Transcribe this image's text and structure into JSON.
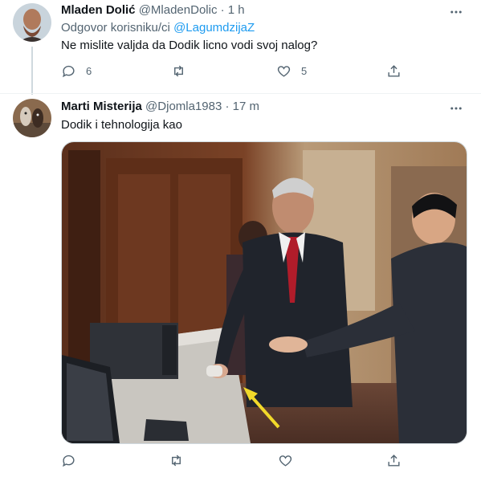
{
  "tweet1": {
    "display_name": "Mladen Dolić",
    "handle": "@MladenDolic",
    "separator": "·",
    "time": "1 h",
    "reply_prefix": "Odgovor korisniku/ci",
    "reply_mention": "@LagumdzijaZ",
    "text": "Ne mislite valjda da Dodik licno vodi svoj nalog?",
    "reply_count": "6",
    "retweet_count": "",
    "like_count": "5"
  },
  "tweet2": {
    "display_name": "Marti Misterija",
    "handle": "@Djomla1983",
    "separator": "·",
    "time": "17 m",
    "text": "Dodik i tehnologija kao",
    "reply_count": "",
    "retweet_count": "",
    "like_count": ""
  },
  "icons": {
    "more": "more-horizontal-icon",
    "reply": "reply-icon",
    "retweet": "retweet-icon",
    "like": "heart-icon",
    "share": "share-icon"
  },
  "colors": {
    "accent": "#1d9bf0",
    "secondary_text": "#536471",
    "primary_text": "#0f1419",
    "thread_line": "#cfd9de"
  }
}
